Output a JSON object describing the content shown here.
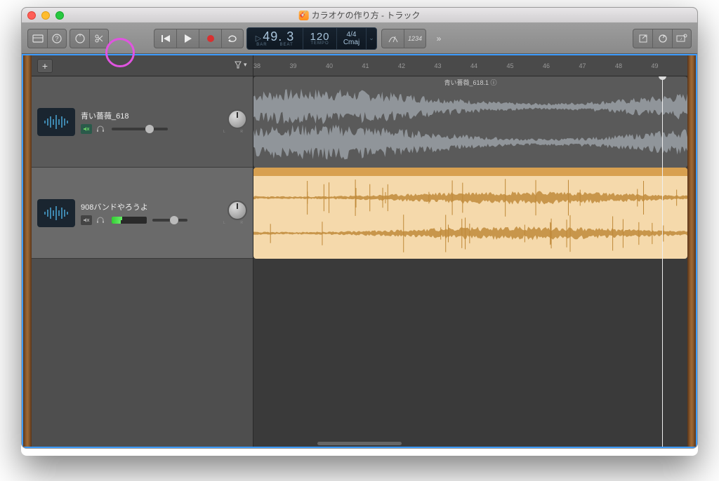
{
  "window": {
    "title": "カラオケの作り方 - トラック"
  },
  "transport": {
    "bar_value": "49.",
    "beat_value": "3",
    "bar_label": "BAR",
    "beat_label": "BEAT",
    "tempo_value": "120",
    "tempo_label": "TEMPO",
    "timesig": "4/4",
    "key": "Cmaj",
    "count_in": "1234"
  },
  "ruler": {
    "ticks": [
      38,
      39,
      40,
      41,
      42,
      43,
      44,
      45,
      46,
      47,
      48,
      49
    ]
  },
  "tracks": [
    {
      "name": "青い薔薇_618",
      "muted": true,
      "region_label": "青い薔薇_618.1 ⓘ",
      "volume_pct": 60,
      "pan_labels": [
        "L",
        "R"
      ],
      "color": "#9aa0a6",
      "bg": "#5a5a5a"
    },
    {
      "name": "908バンドやろうよ",
      "muted": false,
      "region_label": "",
      "volume_pct": 50,
      "meter_pct": 30,
      "pan_labels": [
        "L",
        "R"
      ],
      "color": "#c08a3a",
      "bg": "#f5d9ab"
    }
  ],
  "playhead_bar": 49.3
}
